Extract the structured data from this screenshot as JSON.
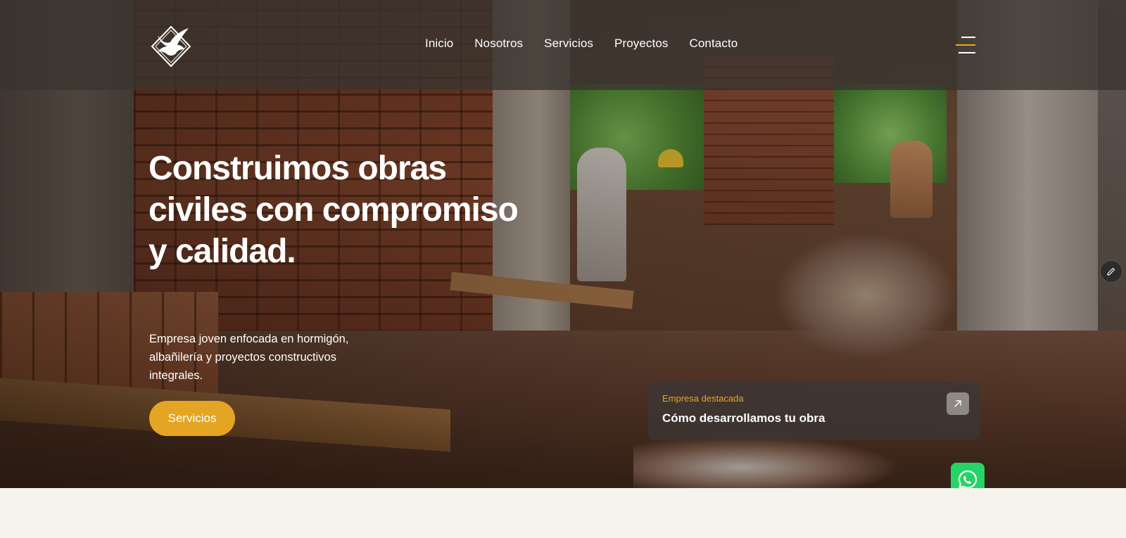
{
  "nav": {
    "items": [
      {
        "label": "Inicio"
      },
      {
        "label": "Nosotros"
      },
      {
        "label": "Servicios"
      },
      {
        "label": "Proyectos"
      },
      {
        "label": "Contacto"
      }
    ]
  },
  "hero": {
    "title": "Construimos obras civiles con compromiso y calidad.",
    "subtitle": "Empresa joven enfocada en hormigón, albañilería y proyectos constructivos integrales.",
    "cta_label": "Servicios"
  },
  "featured_card": {
    "tag": "Empresa destacada",
    "title": "Cómo desarrollamos tu obra"
  },
  "icons": {
    "logo": "eagle-diamond-logo",
    "menu": "hamburger-menu-icon",
    "card_arrow": "arrow-up-right-icon",
    "edit": "pencil-icon",
    "whatsapp": "whatsapp-icon"
  },
  "colors": {
    "accent": "#e3a523",
    "header_bg": "#3a3430",
    "card_bg": "#3c3634",
    "whatsapp": "#25d366",
    "page_bg": "#f4f4ec"
  }
}
